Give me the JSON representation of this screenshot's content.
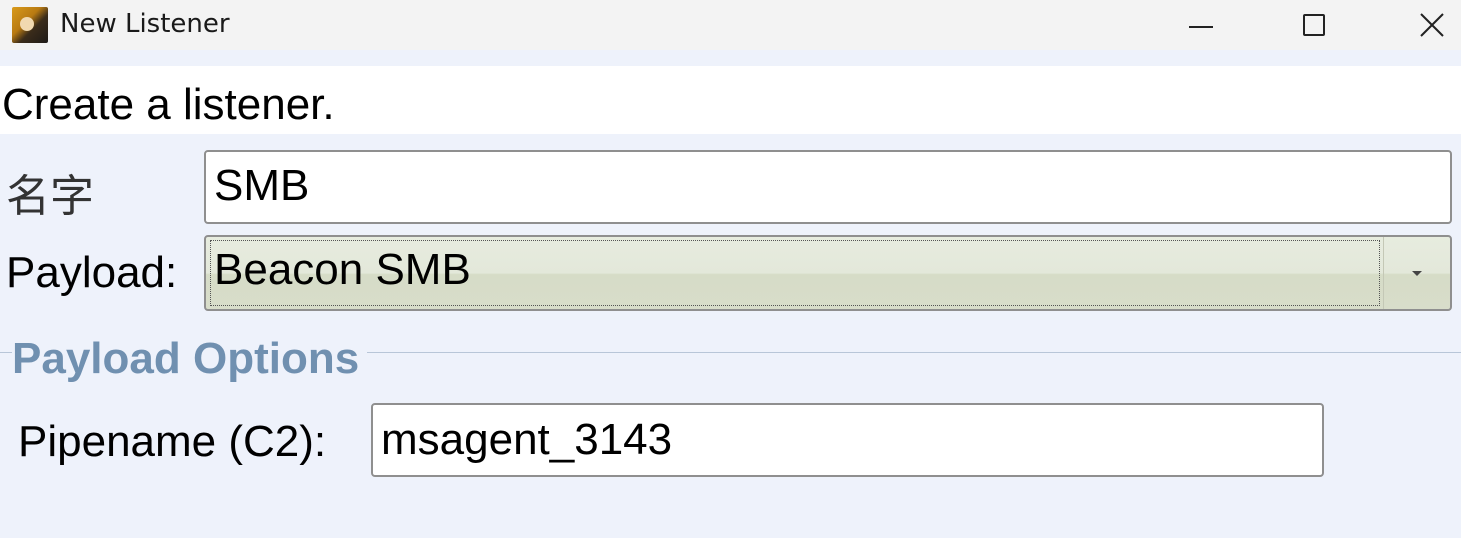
{
  "window": {
    "title": "New Listener",
    "icon": "app-icon",
    "controls": {
      "minimize": "minimize-icon",
      "maximize": "maximize-icon",
      "close": "close-icon"
    }
  },
  "header": {
    "text": "Create a listener."
  },
  "form": {
    "name_label": "名字",
    "name_value": "SMB",
    "payload_label": "Payload:",
    "payload_value": "Beacon SMB"
  },
  "payload_options": {
    "title": "Payload Options",
    "pipename_label": "Pipename (C2):",
    "pipename_value": "msagent_3143"
  },
  "colors": {
    "group_title": "#7090b0",
    "background": "#eef2fb",
    "select_background": "#e3e8da"
  }
}
